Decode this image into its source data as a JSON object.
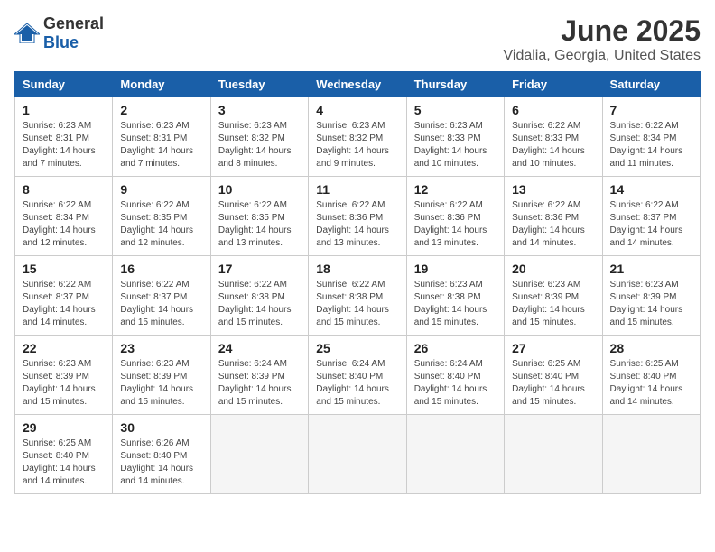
{
  "header": {
    "logo_general": "General",
    "logo_blue": "Blue",
    "month_title": "June 2025",
    "location": "Vidalia, Georgia, United States"
  },
  "days_of_week": [
    "Sunday",
    "Monday",
    "Tuesday",
    "Wednesday",
    "Thursday",
    "Friday",
    "Saturday"
  ],
  "weeks": [
    [
      {
        "day": "1",
        "sunrise": "6:23 AM",
        "sunset": "8:31 PM",
        "daylight": "14 hours and 7 minutes."
      },
      {
        "day": "2",
        "sunrise": "6:23 AM",
        "sunset": "8:31 PM",
        "daylight": "14 hours and 7 minutes."
      },
      {
        "day": "3",
        "sunrise": "6:23 AM",
        "sunset": "8:32 PM",
        "daylight": "14 hours and 8 minutes."
      },
      {
        "day": "4",
        "sunrise": "6:23 AM",
        "sunset": "8:32 PM",
        "daylight": "14 hours and 9 minutes."
      },
      {
        "day": "5",
        "sunrise": "6:23 AM",
        "sunset": "8:33 PM",
        "daylight": "14 hours and 10 minutes."
      },
      {
        "day": "6",
        "sunrise": "6:22 AM",
        "sunset": "8:33 PM",
        "daylight": "14 hours and 10 minutes."
      },
      {
        "day": "7",
        "sunrise": "6:22 AM",
        "sunset": "8:34 PM",
        "daylight": "14 hours and 11 minutes."
      }
    ],
    [
      {
        "day": "8",
        "sunrise": "6:22 AM",
        "sunset": "8:34 PM",
        "daylight": "14 hours and 12 minutes."
      },
      {
        "day": "9",
        "sunrise": "6:22 AM",
        "sunset": "8:35 PM",
        "daylight": "14 hours and 12 minutes."
      },
      {
        "day": "10",
        "sunrise": "6:22 AM",
        "sunset": "8:35 PM",
        "daylight": "14 hours and 13 minutes."
      },
      {
        "day": "11",
        "sunrise": "6:22 AM",
        "sunset": "8:36 PM",
        "daylight": "14 hours and 13 minutes."
      },
      {
        "day": "12",
        "sunrise": "6:22 AM",
        "sunset": "8:36 PM",
        "daylight": "14 hours and 13 minutes."
      },
      {
        "day": "13",
        "sunrise": "6:22 AM",
        "sunset": "8:36 PM",
        "daylight": "14 hours and 14 minutes."
      },
      {
        "day": "14",
        "sunrise": "6:22 AM",
        "sunset": "8:37 PM",
        "daylight": "14 hours and 14 minutes."
      }
    ],
    [
      {
        "day": "15",
        "sunrise": "6:22 AM",
        "sunset": "8:37 PM",
        "daylight": "14 hours and 14 minutes."
      },
      {
        "day": "16",
        "sunrise": "6:22 AM",
        "sunset": "8:37 PM",
        "daylight": "14 hours and 15 minutes."
      },
      {
        "day": "17",
        "sunrise": "6:22 AM",
        "sunset": "8:38 PM",
        "daylight": "14 hours and 15 minutes."
      },
      {
        "day": "18",
        "sunrise": "6:22 AM",
        "sunset": "8:38 PM",
        "daylight": "14 hours and 15 minutes."
      },
      {
        "day": "19",
        "sunrise": "6:23 AM",
        "sunset": "8:38 PM",
        "daylight": "14 hours and 15 minutes."
      },
      {
        "day": "20",
        "sunrise": "6:23 AM",
        "sunset": "8:39 PM",
        "daylight": "14 hours and 15 minutes."
      },
      {
        "day": "21",
        "sunrise": "6:23 AM",
        "sunset": "8:39 PM",
        "daylight": "14 hours and 15 minutes."
      }
    ],
    [
      {
        "day": "22",
        "sunrise": "6:23 AM",
        "sunset": "8:39 PM",
        "daylight": "14 hours and 15 minutes."
      },
      {
        "day": "23",
        "sunrise": "6:23 AM",
        "sunset": "8:39 PM",
        "daylight": "14 hours and 15 minutes."
      },
      {
        "day": "24",
        "sunrise": "6:24 AM",
        "sunset": "8:39 PM",
        "daylight": "14 hours and 15 minutes."
      },
      {
        "day": "25",
        "sunrise": "6:24 AM",
        "sunset": "8:40 PM",
        "daylight": "14 hours and 15 minutes."
      },
      {
        "day": "26",
        "sunrise": "6:24 AM",
        "sunset": "8:40 PM",
        "daylight": "14 hours and 15 minutes."
      },
      {
        "day": "27",
        "sunrise": "6:25 AM",
        "sunset": "8:40 PM",
        "daylight": "14 hours and 15 minutes."
      },
      {
        "day": "28",
        "sunrise": "6:25 AM",
        "sunset": "8:40 PM",
        "daylight": "14 hours and 14 minutes."
      }
    ],
    [
      {
        "day": "29",
        "sunrise": "6:25 AM",
        "sunset": "8:40 PM",
        "daylight": "14 hours and 14 minutes."
      },
      {
        "day": "30",
        "sunrise": "6:26 AM",
        "sunset": "8:40 PM",
        "daylight": "14 hours and 14 minutes."
      },
      null,
      null,
      null,
      null,
      null
    ]
  ]
}
